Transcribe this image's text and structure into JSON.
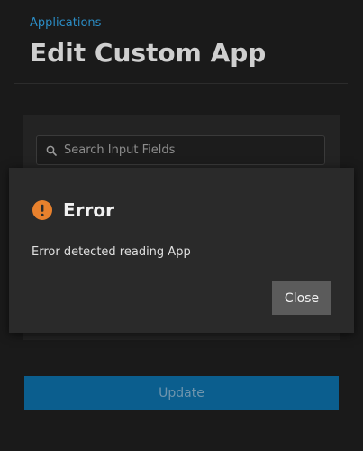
{
  "header": {
    "breadcrumb": "Applications",
    "title": "Edit Custom App"
  },
  "form": {
    "search": {
      "placeholder": "Search Input Fields",
      "value": "",
      "icon": "search-icon"
    },
    "update_label": "Update"
  },
  "dialog": {
    "title": "Error",
    "icon": "error-icon",
    "message": "Error detected reading App",
    "close_label": "Close"
  },
  "colors": {
    "accent": "#0b5e8e",
    "breadcrumb": "#2b8cc4",
    "error": "#e8812d",
    "background": "#1a1a1a"
  }
}
